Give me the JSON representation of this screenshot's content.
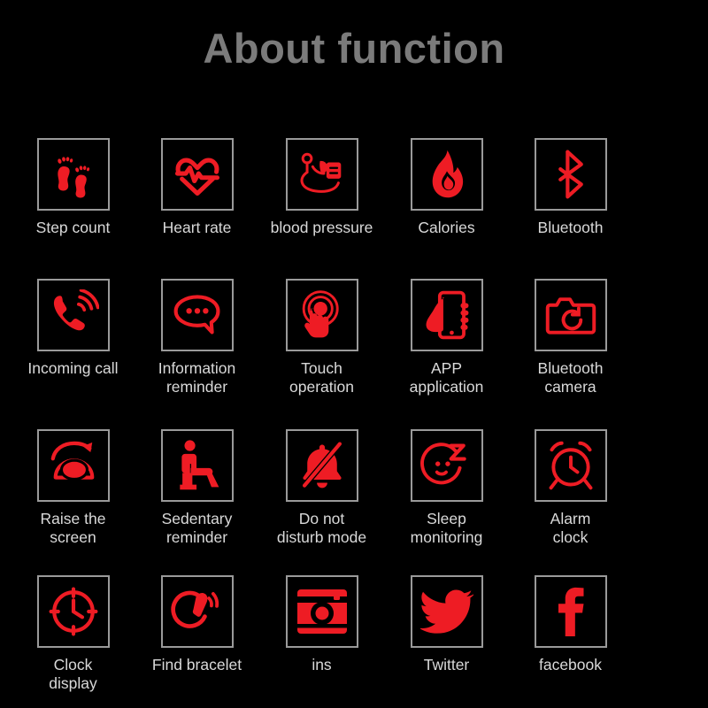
{
  "header": {
    "title": "About function"
  },
  "theme": {
    "background": "#000000",
    "title_color": "#7b7b7b",
    "label_color": "#d9d9d9",
    "icon_color": "#ee1c24",
    "box_border_color": "#9a9a9a"
  },
  "grid": {
    "columns": 5,
    "rows": 4,
    "items": [
      {
        "label": "Step count",
        "icon": "footprints-icon",
        "row": 0,
        "col": 0
      },
      {
        "label": "Heart rate",
        "icon": "heart-pulse-icon",
        "row": 0,
        "col": 1
      },
      {
        "label": "blood pressure",
        "icon": "blood-pressure-icon",
        "row": 0,
        "col": 2
      },
      {
        "label": "Calories",
        "icon": "flame-icon",
        "row": 0,
        "col": 3
      },
      {
        "label": "Bluetooth",
        "icon": "bluetooth-icon",
        "row": 0,
        "col": 4
      },
      {
        "label": "Incoming call",
        "icon": "incoming-call-icon",
        "row": 1,
        "col": 0
      },
      {
        "label": "Information\nreminder",
        "icon": "chat-bubble-icon",
        "row": 1,
        "col": 1
      },
      {
        "label": "Touch\noperation",
        "icon": "touch-operation-icon",
        "row": 1,
        "col": 2
      },
      {
        "label": "APP\napplication",
        "icon": "hand-phone-icon",
        "row": 1,
        "col": 3
      },
      {
        "label": "Bluetooth\ncamera",
        "icon": "camera-icon",
        "row": 1,
        "col": 4
      },
      {
        "label": "Raise the\nscreen",
        "icon": "raise-wrist-eye-icon",
        "row": 2,
        "col": 0
      },
      {
        "label": "Sedentary\nreminder",
        "icon": "seated-person-icon",
        "row": 2,
        "col": 1
      },
      {
        "label": "Do not\ndisturb mode",
        "icon": "bell-slash-icon",
        "row": 2,
        "col": 2
      },
      {
        "label": "Sleep\nmonitoring",
        "icon": "sleep-face-z-icon",
        "row": 2,
        "col": 3
      },
      {
        "label": "Alarm\nclock",
        "icon": "alarm-clock-icon",
        "row": 2,
        "col": 4
      },
      {
        "label": "Clock\ndisplay",
        "icon": "clock-face-icon",
        "row": 3,
        "col": 0
      },
      {
        "label": "Find bracelet",
        "icon": "find-bracelet-icon",
        "row": 3,
        "col": 1
      },
      {
        "label": "ins",
        "icon": "instagram-icon",
        "row": 3,
        "col": 2
      },
      {
        "label": "Twitter",
        "icon": "twitter-bird-icon",
        "row": 3,
        "col": 3
      },
      {
        "label": "facebook",
        "icon": "facebook-f-icon",
        "row": 3,
        "col": 4
      }
    ]
  }
}
